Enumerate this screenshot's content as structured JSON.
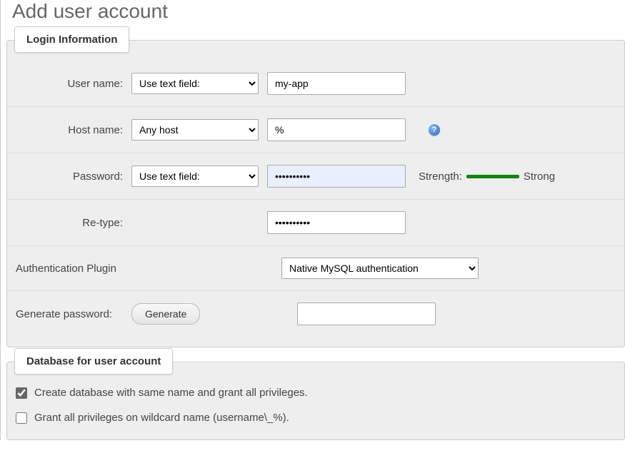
{
  "page": {
    "title": "Add user account"
  },
  "login_info": {
    "legend": "Login Information",
    "username": {
      "label": "User name:",
      "select_options": [
        "Use text field:"
      ],
      "select_value": "Use text field:",
      "value": "my-app"
    },
    "hostname": {
      "label": "Host name:",
      "select_options": [
        "Any host"
      ],
      "select_value": "Any host",
      "value": "%"
    },
    "password": {
      "label": "Password:",
      "select_options": [
        "Use text field:"
      ],
      "select_value": "Use text field:",
      "value": "••••••••••",
      "strength_label": "Strength:",
      "strength_value": "Strong"
    },
    "retype": {
      "label": "Re-type:",
      "value": "••••••••••"
    },
    "auth_plugin": {
      "label": "Authentication Plugin",
      "options": [
        "Native MySQL authentication"
      ],
      "value": "Native MySQL authentication"
    },
    "generate": {
      "label": "Generate password:",
      "button": "Generate",
      "value": ""
    }
  },
  "database_section": {
    "legend": "Database for user account",
    "opt_create_db": {
      "checked": true,
      "label": "Create database with same name and grant all privileges."
    },
    "opt_wildcard": {
      "checked": false,
      "label": "Grant all privileges on wildcard name (username\\_%)."
    }
  }
}
